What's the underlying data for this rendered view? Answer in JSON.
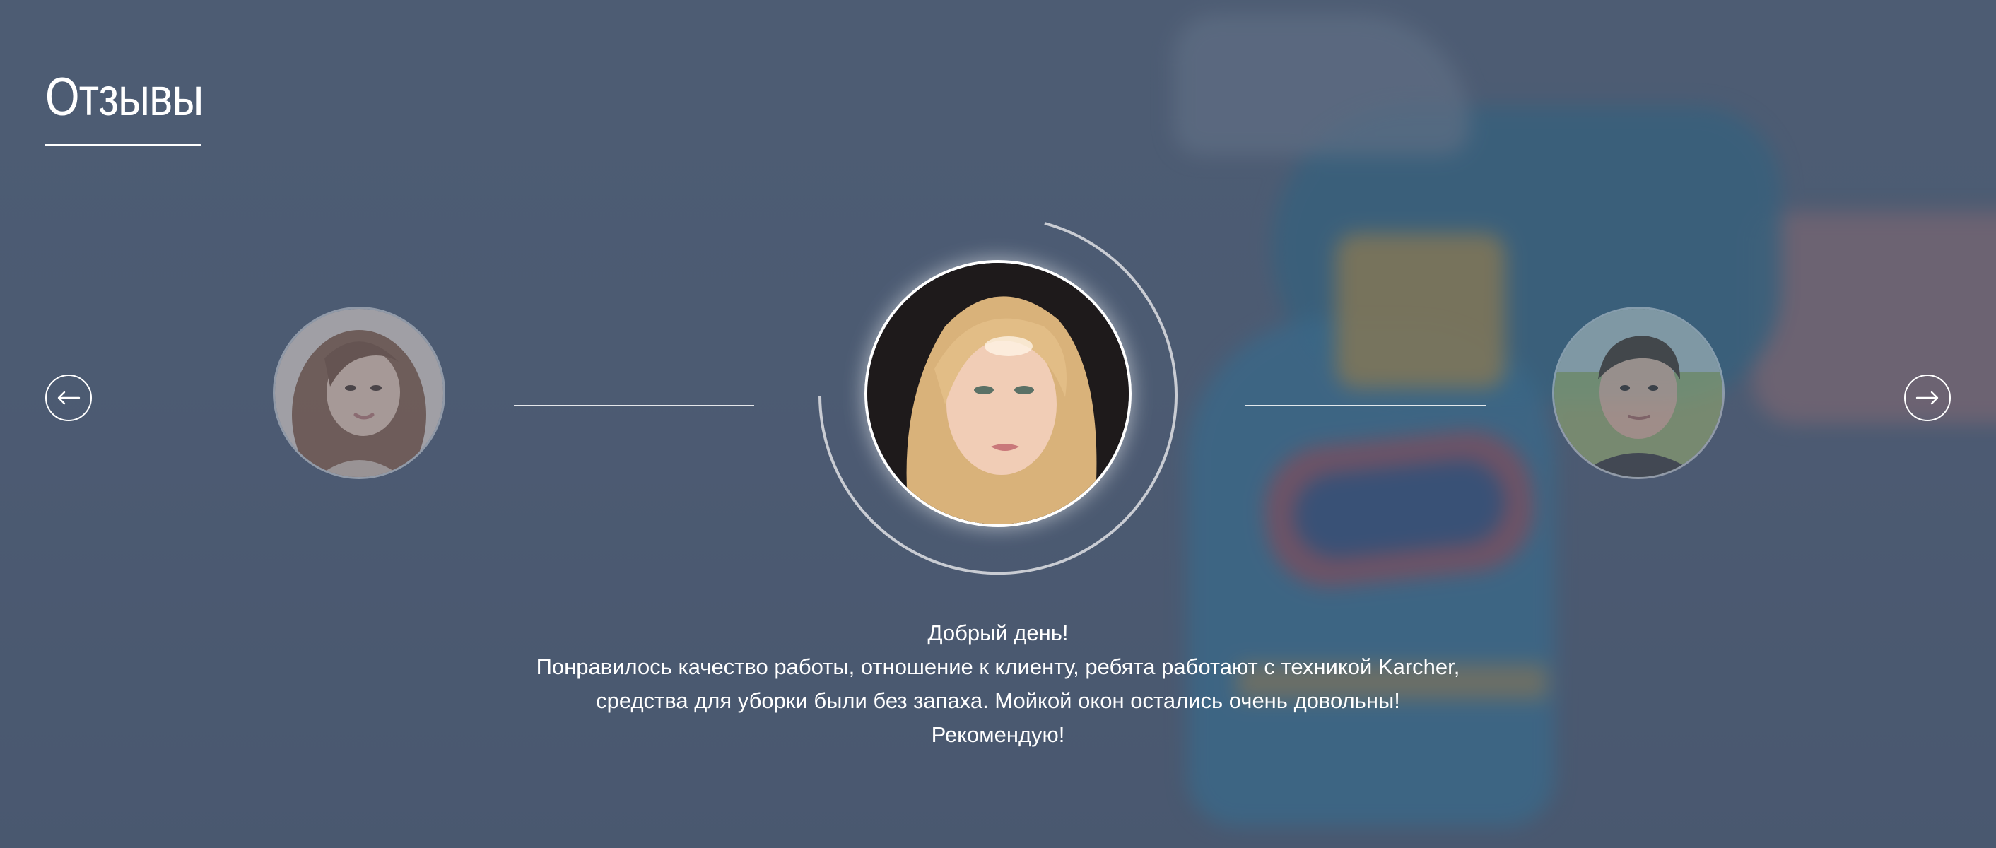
{
  "section": {
    "title": "Отзывы"
  },
  "slider": {
    "prev_icon": "arrow-left-icon",
    "next_icon": "arrow-right-icon",
    "avatars": [
      {
        "name": "reviewer-left-avatar",
        "state": "inactive"
      },
      {
        "name": "reviewer-main-avatar",
        "state": "active"
      },
      {
        "name": "reviewer-right-avatar",
        "state": "inactive"
      }
    ]
  },
  "review": {
    "lines": [
      "Добрый день!",
      "Понравилось качество работы, отношение к клиенту, ребята работают с техникой Karcher,",
      "средства для уборки были без запаха. Мойкой окон остались очень довольны!",
      "Рекомендую!"
    ]
  },
  "colors": {
    "text": "#ffffff",
    "overlay": "#55647b",
    "accent_ring": "#c9ccd3"
  }
}
